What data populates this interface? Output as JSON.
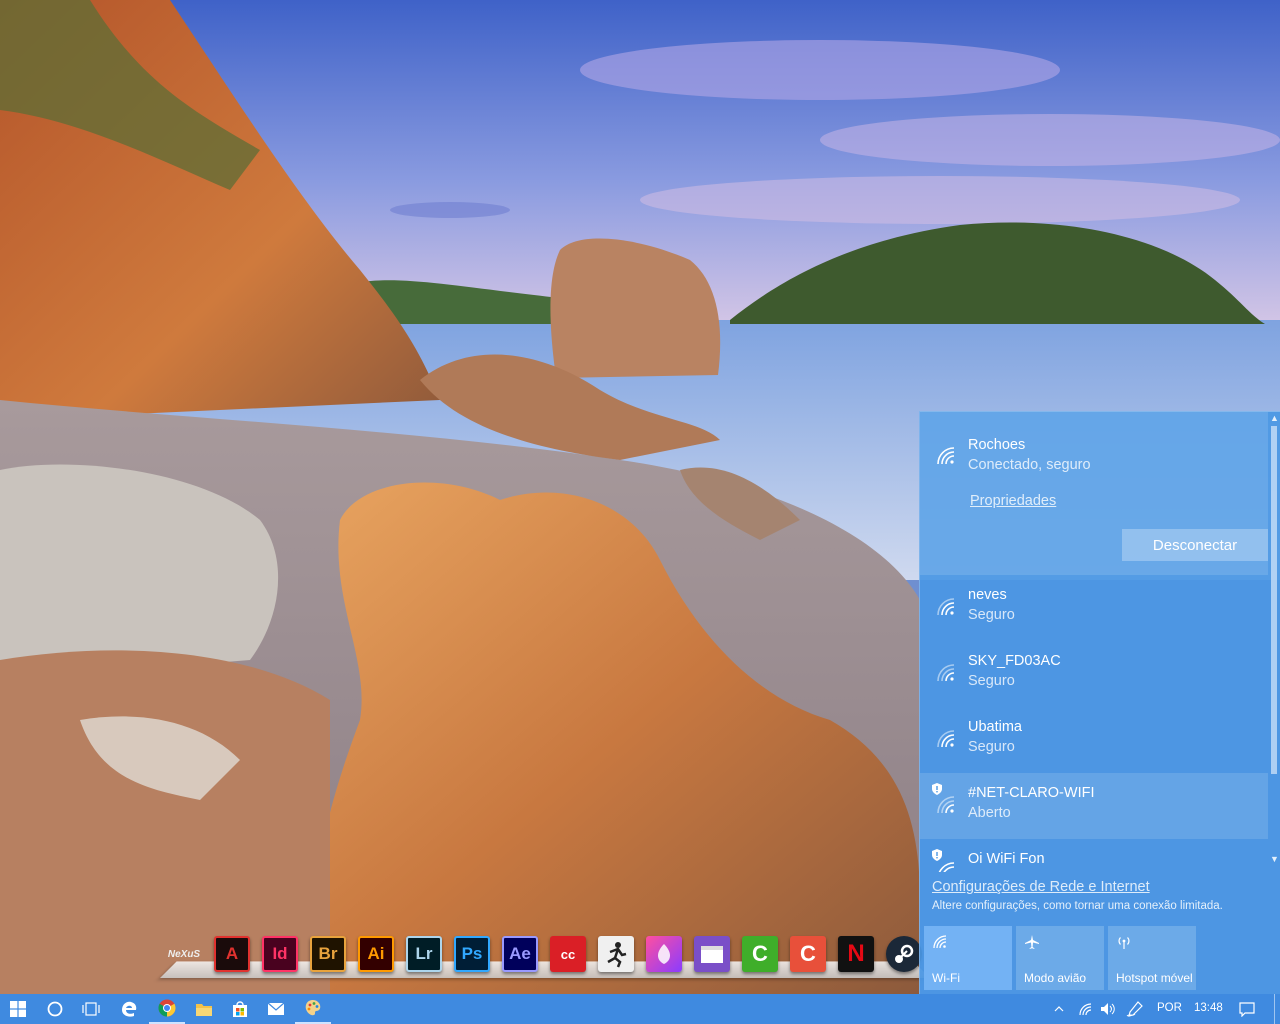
{
  "flyout": {
    "networks": [
      {
        "ssid": "Rochoes",
        "status": "Conectado, seguro",
        "secured": true
      },
      {
        "ssid": "neves",
        "status": "Seguro",
        "secured": true
      },
      {
        "ssid": "SKY_FD03AC",
        "status": "Seguro",
        "secured": true
      },
      {
        "ssid": "Ubatima",
        "status": "Seguro",
        "secured": true
      },
      {
        "ssid": "#NET-CLARO-WIFI",
        "status": "Aberto",
        "secured": false
      },
      {
        "ssid": "Oi WiFi Fon",
        "status": "",
        "secured": false
      }
    ],
    "properties_link": "Propriedades",
    "disconnect_label": "Desconectar",
    "settings_link": "Configurações de Rede e Internet",
    "settings_desc": "Altere configurações, como tornar uma conexão limitada.",
    "quick_actions": [
      {
        "label": "Wi-Fi",
        "active": true,
        "icon": "wifi-icon"
      },
      {
        "label": "Modo avião",
        "active": false,
        "icon": "airplane-icon"
      },
      {
        "label": "Hotspot móvel",
        "active": false,
        "icon": "hotspot-icon"
      }
    ]
  },
  "dock": {
    "apps": [
      {
        "name": "nexus",
        "label": "NeXuS"
      },
      {
        "name": "acrobat",
        "label": "A"
      },
      {
        "name": "indesign",
        "label": "Id"
      },
      {
        "name": "bridge",
        "label": "Br"
      },
      {
        "name": "illustrator",
        "label": "Ai"
      },
      {
        "name": "lightroom",
        "label": "Lr"
      },
      {
        "name": "photoshop",
        "label": "Ps"
      },
      {
        "name": "after-effects",
        "label": "Ae"
      },
      {
        "name": "creative-cloud",
        "label": "cc"
      },
      {
        "name": "zbrush",
        "label": ""
      },
      {
        "name": "paint-3d",
        "label": ""
      },
      {
        "name": "movie-maker",
        "label": ""
      },
      {
        "name": "camtasia",
        "label": "C"
      },
      {
        "name": "camtasia-recorder",
        "label": "C"
      },
      {
        "name": "netflix",
        "label": "N"
      },
      {
        "name": "steam",
        "label": ""
      }
    ]
  },
  "taskbar": {
    "language": "POR",
    "time": "13:48",
    "pinned": [
      "start",
      "cortana",
      "task-view",
      "edge",
      "chrome",
      "file-explorer",
      "store",
      "mail",
      "paint"
    ]
  },
  "colors": {
    "flyout_bg": "#4a97e4",
    "taskbar_bg": "#3f8ae0",
    "accent": "#3f8ae0"
  }
}
